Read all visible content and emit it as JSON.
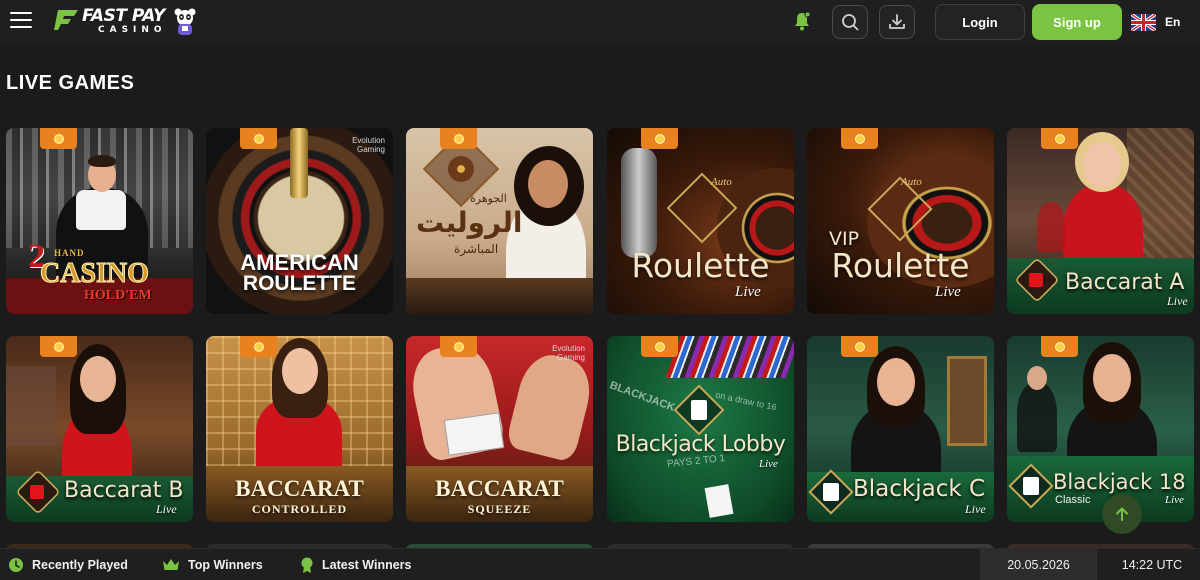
{
  "header": {
    "logo_top": "FAST PAY",
    "logo_bottom": "CASINO",
    "login_label": "Login",
    "signup_label": "Sign up",
    "language": "En",
    "accent_color": "#7bc443"
  },
  "page": {
    "title": "LIVE GAMES"
  },
  "games_row1": [
    {
      "title": "2HAND CASINO HOLD'EM",
      "line1": "2 HAND",
      "line2": "CASINO",
      "line3": "HOLD'EM"
    },
    {
      "title": "AMERICAN ROULETTE",
      "line1": "AMERICAN",
      "line2": "ROULETTE",
      "provider": "Evolution Gaming"
    },
    {
      "title": "الروليت المباشرة",
      "line1": "الجوهرة",
      "line2": "الروليت",
      "line3": "المباشرة"
    },
    {
      "title": "Roulette Live",
      "tag": "Auto",
      "line1": "Roulette",
      "sub": "Live"
    },
    {
      "title": "VIP Roulette Live",
      "tag": "Auto",
      "line0": "VIP",
      "line1": "Roulette",
      "sub": "Live"
    },
    {
      "title": "Baccarat A Live",
      "line1": "Baccarat A",
      "sub": "Live"
    }
  ],
  "games_row2": [
    {
      "title": "Baccarat B Live",
      "line1": "Baccarat B",
      "sub": "Live"
    },
    {
      "title": "BACCARAT CONTROLLED",
      "line1": "BACCARAT",
      "line2": "CONTROLLED"
    },
    {
      "title": "BACCARAT SQUEEZE",
      "line1": "BACCARAT",
      "line2": "SQUEEZE",
      "provider": "Evolution Gaming"
    },
    {
      "title": "Blackjack Lobby Live",
      "line1": "Blackjack Lobby",
      "sub": "Live",
      "felt1": "BLACKJACK PAYS",
      "felt2": "PAYS 2 TO 1",
      "felt3": "on a draw to 16"
    },
    {
      "title": "Blackjack C Live",
      "line1": "Blackjack C",
      "sub": "Live"
    },
    {
      "title": "Blackjack 18 Classic Live",
      "line1": "Blackjack 18",
      "sub2": "Classic",
      "sub": "Live"
    }
  ],
  "footer": {
    "recently_played": "Recently Played",
    "top_winners": "Top Winners",
    "latest_winners": "Latest Winners",
    "date": "20.05.2026",
    "time": "14:22 UTC"
  }
}
